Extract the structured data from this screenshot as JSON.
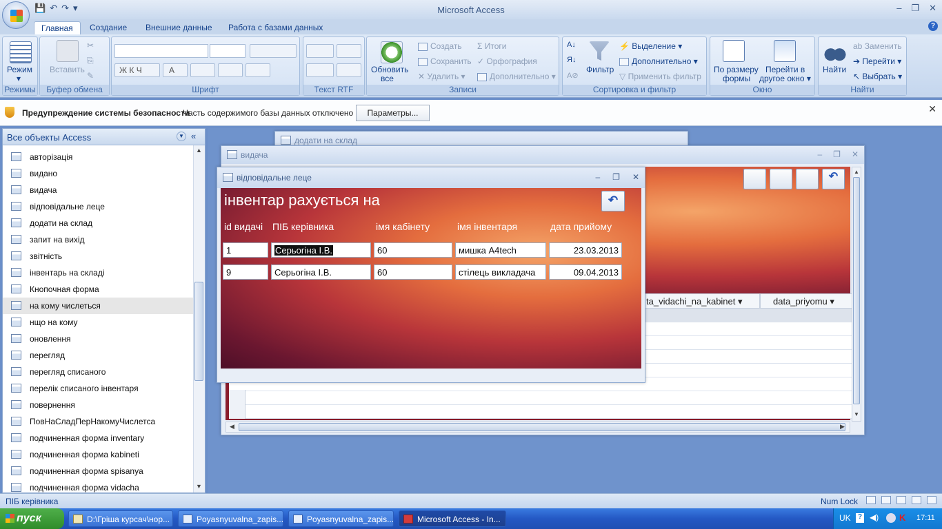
{
  "app": {
    "title": "Microsoft Access"
  },
  "ribbon_tabs": [
    "Главная",
    "Создание",
    "Внешние данные",
    "Работа с базами данных"
  ],
  "ribbon": {
    "groups": {
      "modes": "Режимы",
      "clipboard": "Буфер обмена",
      "font": "Шрифт",
      "rtf": "Текст RTF",
      "records": "Записи",
      "sort": "Сортировка и фильтр",
      "window": "Окно",
      "find": "Найти"
    },
    "mode_btn": "Режим",
    "paste_btn": "Вставить",
    "refresh_btn_1": "Обновить",
    "refresh_btn_2": "все",
    "records": {
      "create": "Создать",
      "save": "Сохранить",
      "delete": "Удалить",
      "totals": "Итоги",
      "spelling": "Орфография",
      "more": "Дополнительно"
    },
    "filter_btn": "Фильтр",
    "sort": {
      "selection": "Выделение",
      "advanced": "Дополнительно",
      "apply": "Применить фильтр"
    },
    "window": {
      "fit_1": "По размеру",
      "fit_2": "формы",
      "switch_1": "Перейти в",
      "switch_2": "другое окно"
    },
    "find": {
      "find_btn": "Найти",
      "replace": "Заменить",
      "goto": "Перейти",
      "select": "Выбрать"
    }
  },
  "security": {
    "title": "Предупреждение системы безопасности",
    "message": "Часть содержимого базы данных отключено",
    "button": "Параметры..."
  },
  "nav": {
    "header": "Все объекты Access",
    "items": [
      "авторізація",
      "видано",
      "видача",
      "відповідальне леце",
      "додати на склад",
      "запит на вихід",
      "звітність",
      "інвентарь на складі",
      "Кнопочная форма",
      "на кому числеться",
      "нщо на кому",
      "оновлення",
      "перегляд",
      "перегляд списаного",
      "перелік списаного інвентаря",
      "повернення",
      "ПовНаСладПерНакомуЧислетса",
      "подчиненная форма inventary",
      "подчиненная форма kabineti",
      "подчиненная форма spisanya",
      "подчиненная форма vidacha"
    ]
  },
  "windows": {
    "back": {
      "title": "додати на склад"
    },
    "vidacha": {
      "title": "видача",
      "columns": [
        "ta_vidachi_na_kabinet",
        "data_priyomu"
      ]
    },
    "front": {
      "title": "відповідальне леце",
      "heading": "інвентар рахується на",
      "labels": [
        "id видачі",
        "ПІБ керівника",
        "імя кабінету",
        "імя інвентаря",
        "дата прийому"
      ],
      "rows": [
        {
          "id": "1",
          "pib": "Серьогіна І.В.",
          "cabinet": "60",
          "item": "мишка A4tech",
          "date": "23.03.2013"
        },
        {
          "id": "9",
          "pib": "Серьогіна І.В.",
          "cabinet": "60",
          "item": "стілець викладача",
          "date": "09.04.2013"
        }
      ]
    }
  },
  "status": {
    "left": "ПІБ керівника",
    "numlock": "Num Lock"
  },
  "taskbar": {
    "start": "пуск",
    "tasks": [
      "D:\\Гріша курсач\\нор...",
      "Poyasnyuvalna_zapis...",
      "Poyasnyuvalna_zapis...",
      "Microsoft Access - In..."
    ],
    "lang": "UK",
    "clock": "17:11"
  }
}
